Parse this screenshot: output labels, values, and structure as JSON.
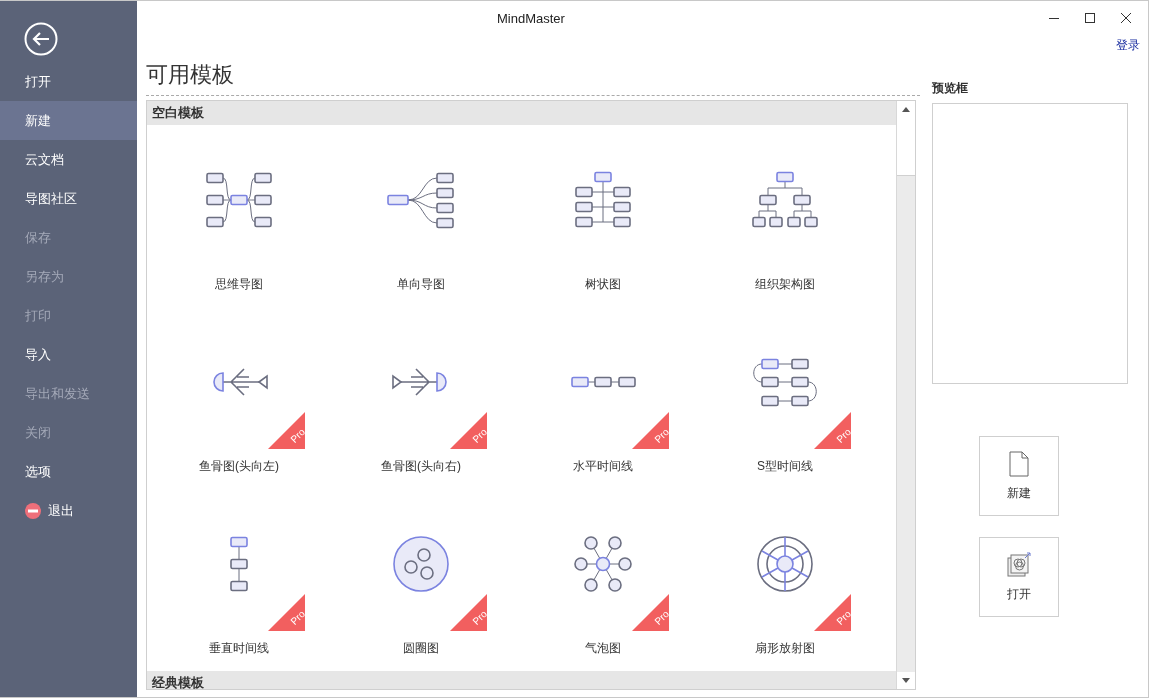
{
  "window": {
    "title": "MindMaster",
    "login_link": "登录"
  },
  "sidebar": {
    "items": [
      {
        "label": "打开",
        "kind": "plain",
        "selected": false,
        "disabled": false
      },
      {
        "label": "新建",
        "kind": "plain",
        "selected": true,
        "disabled": false
      },
      {
        "label": "云文档",
        "kind": "plain",
        "selected": false,
        "disabled": false
      },
      {
        "label": "导图社区",
        "kind": "plain",
        "selected": false,
        "disabled": false
      },
      {
        "label": "保存",
        "kind": "plain",
        "selected": false,
        "disabled": true
      },
      {
        "label": "另存为",
        "kind": "plain",
        "selected": false,
        "disabled": true
      },
      {
        "label": "打印",
        "kind": "plain",
        "selected": false,
        "disabled": true
      },
      {
        "label": "导入",
        "kind": "plain",
        "selected": false,
        "disabled": false
      },
      {
        "label": "导出和发送",
        "kind": "plain",
        "selected": false,
        "disabled": true
      },
      {
        "label": "关闭",
        "kind": "plain",
        "selected": false,
        "disabled": true
      },
      {
        "label": "选项",
        "kind": "plain",
        "selected": false,
        "disabled": false
      },
      {
        "label": "退出",
        "kind": "exit",
        "selected": false,
        "disabled": false
      }
    ]
  },
  "heading": "可用模板",
  "sections": [
    {
      "title": "空白模板",
      "templates": [
        {
          "name": "思维导图",
          "kind": "mind-map"
        },
        {
          "name": "单向导图",
          "kind": "one-way"
        },
        {
          "name": "树状图",
          "kind": "tree"
        },
        {
          "name": "组织架构图",
          "kind": "org"
        },
        {
          "name": "鱼骨图(头向左)",
          "kind": "fishbone-left",
          "badge": "Pro"
        },
        {
          "name": "鱼骨图(头向右)",
          "kind": "fishbone-right",
          "badge": "Pro"
        },
        {
          "name": "水平时间线",
          "kind": "h-timeline",
          "badge": "Pro"
        },
        {
          "name": "S型时间线",
          "kind": "s-timeline",
          "badge": "Pro"
        },
        {
          "name": "垂直时间线",
          "kind": "v-timeline",
          "badge": "Pro"
        },
        {
          "name": "圆圈图",
          "kind": "circle",
          "badge": "Pro"
        },
        {
          "name": "气泡图",
          "kind": "bubble",
          "badge": "Pro"
        },
        {
          "name": "扇形放射图",
          "kind": "fan",
          "badge": "Pro"
        }
      ]
    },
    {
      "title": "经典模板"
    }
  ],
  "preview": {
    "title": "预览框"
  },
  "actions": [
    {
      "label": "新建",
      "kind": "new"
    },
    {
      "label": "打开",
      "kind": "open"
    }
  ]
}
